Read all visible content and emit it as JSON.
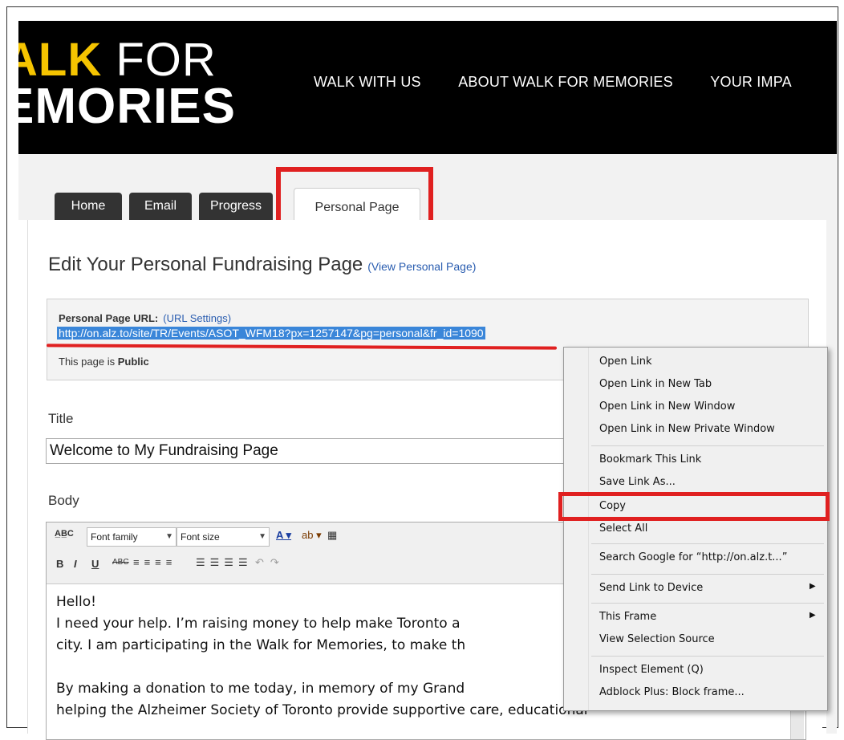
{
  "header": {
    "logo_line1_yellow": "ALK",
    "logo_line1_white": " FOR",
    "logo_line2": "EMORIES",
    "nav": [
      "WALK WITH US",
      "ABOUT WALK FOR MEMORIES",
      "YOUR IMPA"
    ]
  },
  "tabs": [
    "Home",
    "Email",
    "Progress",
    "Personal Page"
  ],
  "page": {
    "heading": "Edit Your Personal Fundraising Page",
    "view_link": "(View Personal Page)",
    "url_label": "Personal Page URL:",
    "url_settings": "(URL Settings)",
    "url": "http://on.alz.to/site/TR/Events/ASOT_WFM18?px=1257147&pg=personal&fr_id=1090",
    "public_prefix": "This page is",
    "public_value": "Public",
    "title_label": "Title",
    "title_value": "Welcome to My Fundraising Page",
    "body_label": "Body"
  },
  "editor": {
    "font_family": "Font family",
    "font_size": "Font size",
    "lines": [
      "Hello!",
      "I need your help. I’m raising money to help make Toronto a",
      "city. I am participating in the Walk for Memories, to make th",
      "",
      "By making a donation to me today, in memory of my Grand",
      "helping the Alzheimer Society of Toronto provide supportive care, educational"
    ]
  },
  "context_menu": {
    "items": [
      "Open Link",
      "Open Link in New Tab",
      "Open Link in New Window",
      "Open Link in New Private Window",
      "Bookmark This Link",
      "Save Link As...",
      "Copy",
      "Select All",
      "Search Google for “http://on.alz.t...”",
      "Send Link to Device",
      "This Frame",
      "View Selection Source",
      "Inspect Element (Q)",
      "Adblock Plus: Block frame..."
    ]
  },
  "colors": {
    "accent_red": "#e02020",
    "logo_yellow": "#f5c400",
    "link_blue": "#2a5db0"
  }
}
